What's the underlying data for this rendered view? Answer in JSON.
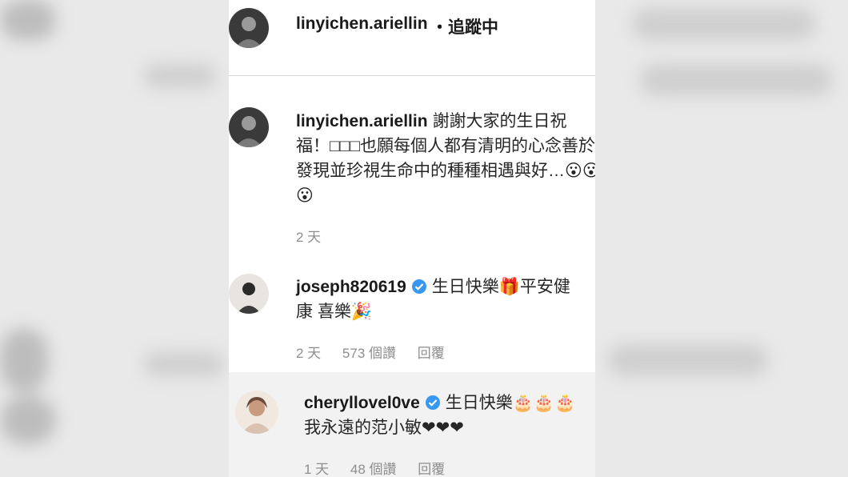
{
  "header": {
    "username": "linyichen.ariellin",
    "follow_status": "・追蹤中"
  },
  "caption": {
    "username": "linyichen.ariellin",
    "text": "謝謝大家的生日祝福！□□□也願每個人都有清明的心念善於發現並珍視生命中的種種相遇與好…😮😮😮",
    "time": "2 天"
  },
  "comments": [
    {
      "username": "joseph820619",
      "verified": true,
      "text": "生日快樂🎁平安健康 喜樂🎉",
      "time": "2 天",
      "likes": "573 個讚",
      "reply": "回覆"
    },
    {
      "username": "cheryllovel0ve",
      "verified": true,
      "text": "生日快樂🎂🎂🎂我永遠的范小敏❤❤❤",
      "time": "1 天",
      "likes": "48 個讚",
      "reply": "回覆"
    }
  ],
  "colors": {
    "verified_badge": "#3897f0",
    "meta_text": "#8e8e8e",
    "divider": "#dbdbdb"
  }
}
